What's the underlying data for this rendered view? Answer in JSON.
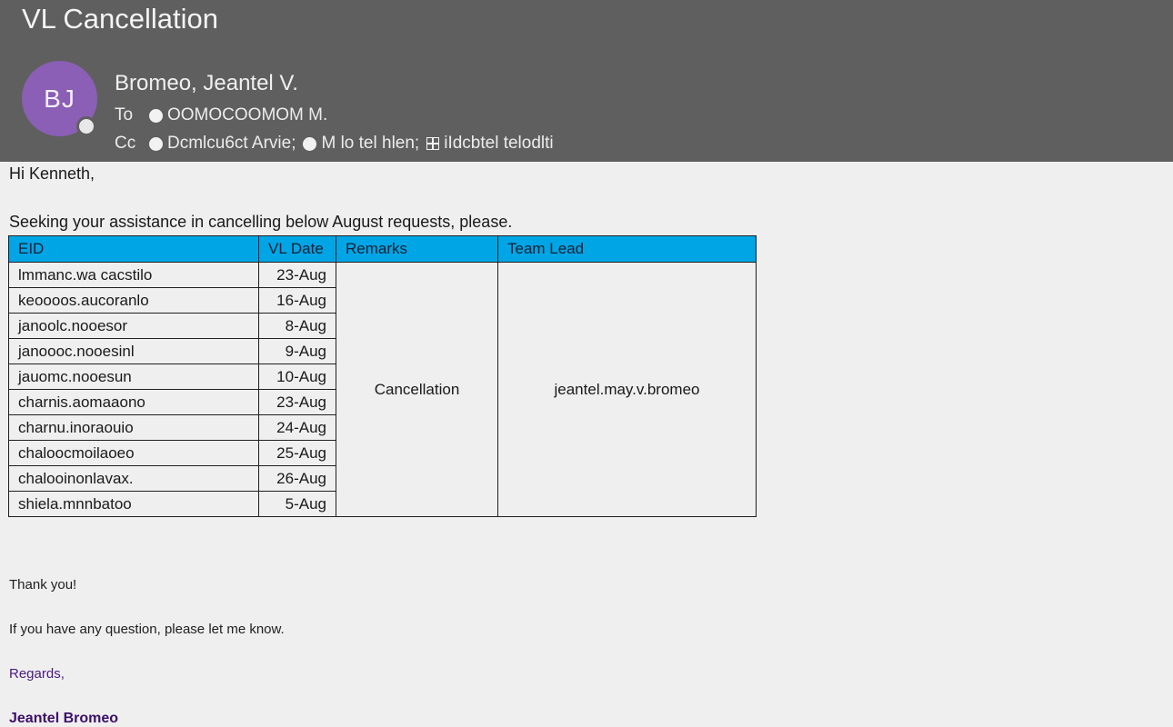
{
  "email": {
    "subject": "VL Cancellation",
    "sender": {
      "initials": "BJ",
      "name": "Bromeo, Jeantel V.",
      "avatar_color": "#8a5fb5"
    },
    "to": {
      "label": "To",
      "recipients": [
        "OOMOCOOMOM M."
      ]
    },
    "cc": {
      "label": "Cc",
      "recipients": [
        "Dcmlcu6ct Arvie;",
        "M lo tel hlen;",
        "iIdcbtel telodlti"
      ]
    }
  },
  "body": {
    "greeting": "Hi Kenneth,",
    "intro": "Seeking your assistance in cancelling below August requests, please.",
    "table": {
      "header_color": "#00a5e6",
      "columns": [
        "EID",
        "VL Date",
        "Remarks",
        "Team Lead"
      ],
      "rows": [
        {
          "eid": "lmmanc.wa cacstilo",
          "date": "23-Aug"
        },
        {
          "eid": "keoooos.aucoranlo",
          "date": "16-Aug"
        },
        {
          "eid": "janoolc.nooesor",
          "date": "8-Aug"
        },
        {
          "eid": "janoooc.nooesinl",
          "date": "9-Aug"
        },
        {
          "eid": "jauomc.nooesun",
          "date": "10-Aug"
        },
        {
          "eid": "charnis.aomaaono",
          "date": "23-Aug"
        },
        {
          "eid": "charnu.inoraouio",
          "date": "24-Aug"
        },
        {
          "eid": "chaloocmoilaoeo",
          "date": "25-Aug"
        },
        {
          "eid": "chalooinonlavax.",
          "date": "26-Aug"
        },
        {
          "eid": "shiela.mnnbatoo",
          "date": "5-Aug"
        }
      ],
      "remarks": "Cancellation",
      "team_lead": "jeantel.may.v.bromeo"
    },
    "thanks": "Thank you!",
    "question": "If you have any question, please let me know.",
    "regards": "Regards,",
    "signature": "Jeantel Bromeo"
  }
}
